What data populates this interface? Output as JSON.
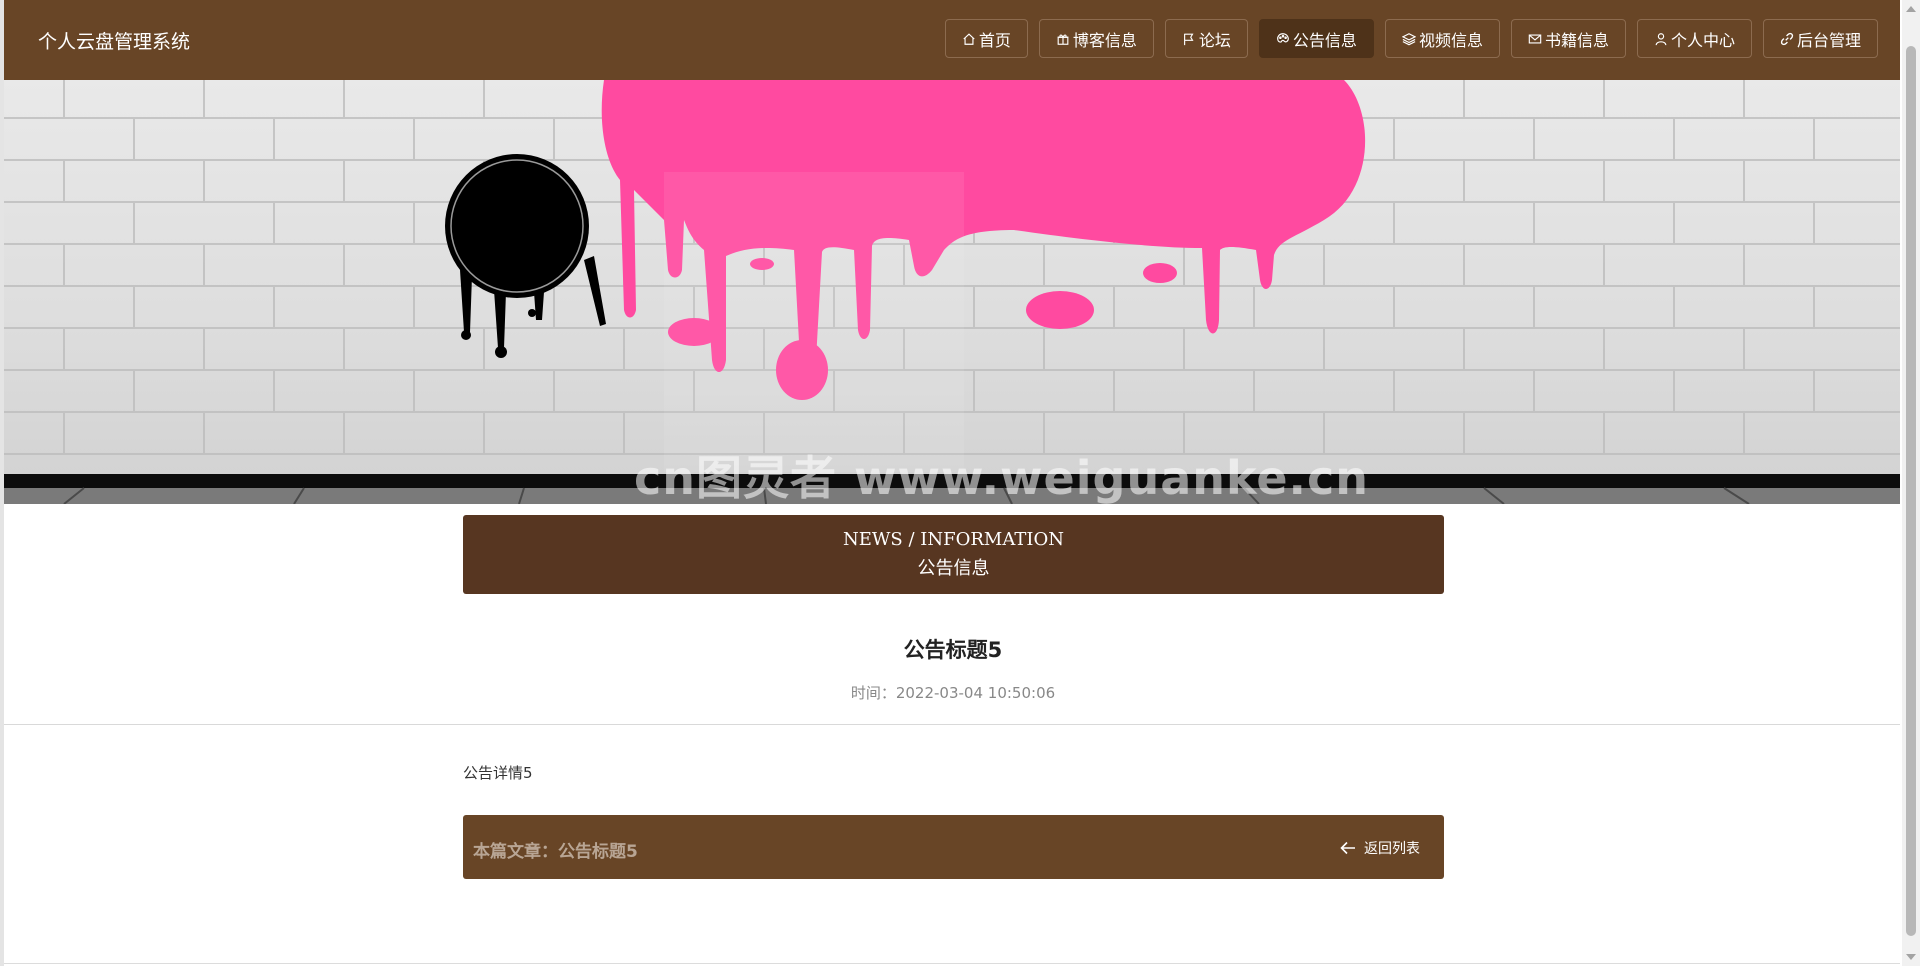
{
  "site": {
    "title": "个人云盘管理系统"
  },
  "nav": {
    "items": [
      {
        "label": "首页",
        "icon": "home-icon",
        "active": false
      },
      {
        "label": "博客信息",
        "icon": "gift-icon",
        "active": false
      },
      {
        "label": "论坛",
        "icon": "flag-icon",
        "active": false
      },
      {
        "label": "公告信息",
        "icon": "palette-icon",
        "active": true
      },
      {
        "label": "视频信息",
        "icon": "layers-icon",
        "active": false
      },
      {
        "label": "书籍信息",
        "icon": "mail-icon",
        "active": false
      },
      {
        "label": "个人中心",
        "icon": "user-icon",
        "active": false
      },
      {
        "label": "后台管理",
        "icon": "link-icon",
        "active": false
      }
    ]
  },
  "banner": {
    "watermark": "cn图灵者 www.weiguanke.cn"
  },
  "section": {
    "en": "NEWS / INFORMATION",
    "cn": "公告信息"
  },
  "article": {
    "title": "公告标题5",
    "time": "时间：2022-03-04 10:50:06",
    "body": "公告详情5"
  },
  "footer": {
    "current": "本篇文章：公告标题5",
    "back_label": "返回列表"
  },
  "colors": {
    "header_bg": "#684526",
    "section_bg": "#573621",
    "active_nav": "#4e3219",
    "paint_pink": "#ff4aa0"
  }
}
